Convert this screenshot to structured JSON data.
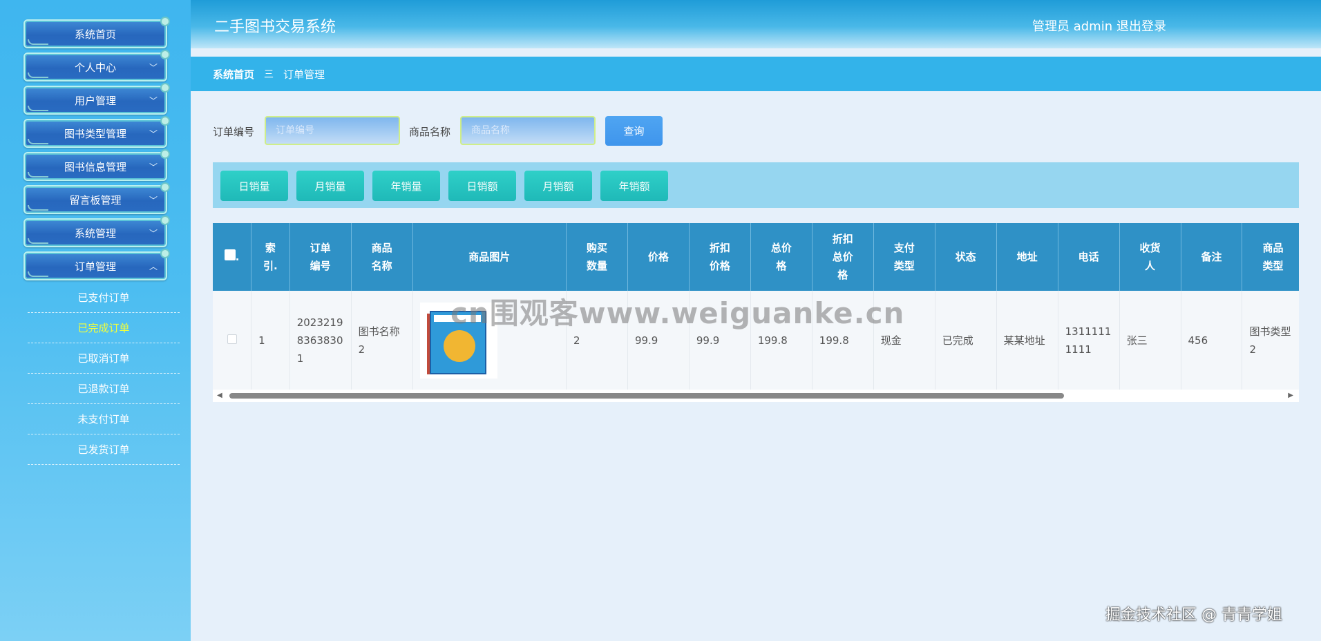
{
  "sidebar": {
    "menu": [
      {
        "label": "系统首页",
        "chevron": ""
      },
      {
        "label": "个人中心",
        "chevron": "﹀"
      },
      {
        "label": "用户管理",
        "chevron": "﹀"
      },
      {
        "label": "图书类型管理",
        "chevron": "﹀"
      },
      {
        "label": "图书信息管理",
        "chevron": "﹀"
      },
      {
        "label": "留言板管理",
        "chevron": "﹀"
      },
      {
        "label": "系统管理",
        "chevron": "﹀"
      },
      {
        "label": "订单管理",
        "chevron": "︿"
      }
    ],
    "submenu": [
      "已支付订单",
      "已完成订单",
      "已取消订单",
      "已退款订单",
      "未支付订单",
      "已发货订单"
    ],
    "active_submenu": "已完成订单"
  },
  "header": {
    "title": "二手图书交易系统",
    "user": "管理员 admin",
    "logout": "退出登录"
  },
  "breadcrumb": {
    "home": "系统首页",
    "separator": "三",
    "current": "订单管理"
  },
  "search": {
    "order_label": "订单编号",
    "order_placeholder": "订单编号",
    "product_label": "商品名称",
    "product_placeholder": "商品名称",
    "query_button": "查询"
  },
  "stats": [
    "日销量",
    "月销量",
    "年销量",
    "日销额",
    "月销额",
    "年销额"
  ],
  "table": {
    "headers": [
      "索\n引.",
      "订单\n编号",
      "商品\n名称",
      "商品图片",
      "购买\n数量",
      "价格",
      "折扣\n价格",
      "总价\n格",
      "折扣\n总价\n格",
      "支付\n类型",
      "状态",
      "地址",
      "电话",
      "收货\n人",
      "备注",
      "商品\n类型"
    ],
    "rows": [
      {
        "index": "1",
        "order_no": "20232198363830 1",
        "order_no_display": "2023219\n8363830\n1",
        "product_name": "图书名称\n2",
        "quantity": "2",
        "price": "99.9",
        "discount_price": "99.9",
        "total": "199.8",
        "discount_total": "199.8",
        "pay_type": "现金",
        "status": "已完成",
        "address": "某某地址",
        "phone": "1311111\n1111",
        "receiver": "张三",
        "note": "456",
        "product_type": "图书类型\n2"
      }
    ]
  },
  "watermark": "cn围观客www.weiguanke.cn",
  "credit": "掘金技术社区 @ 青青学姐",
  "colors": {
    "sidebar": "#3fb6ef",
    "header": "#1f9cd8",
    "breadcrumb": "#33b3ea",
    "table_header": "#2f91c6",
    "stat_button": "#1fb9b8",
    "active_submenu": "#f2ff3a"
  }
}
